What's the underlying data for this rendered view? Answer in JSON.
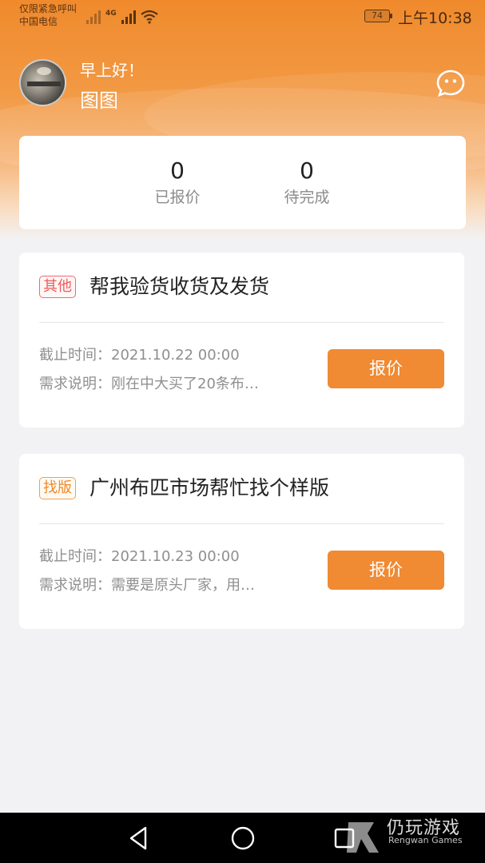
{
  "status_bar": {
    "carrier_line1": "仅限紧急呼叫",
    "carrier_line2": "中国电信",
    "network": "4G",
    "battery": "74",
    "time": "上午10:38"
  },
  "header": {
    "greeting": "早上好！",
    "username": "图图",
    "message_icon": "chat-bubble-icon"
  },
  "stats": [
    {
      "value": "0",
      "label": "已报价"
    },
    {
      "value": "0",
      "label": "待完成"
    }
  ],
  "tasks": [
    {
      "tag": "其他",
      "tag_color": "#ef5b5b",
      "title": "帮我验货收货及发货",
      "deadline": "截止时间：2021.10.22 00:00",
      "description": "需求说明：刚在中大买了20条布…",
      "button": "报价"
    },
    {
      "tag": "找版",
      "tag_color": "#ef8a2a",
      "title": "广州布匹市场帮忙找个样版",
      "deadline": "截止时间：2021.10.23 00:00",
      "description": "需求说明：需要是原头厂家，用…",
      "button": "报价"
    }
  ],
  "colors": {
    "accent": "#f08a33",
    "background": "#f2f2f4"
  },
  "watermark": {
    "title": "仍玩游戏",
    "subtitle": "Rengwan Games"
  }
}
